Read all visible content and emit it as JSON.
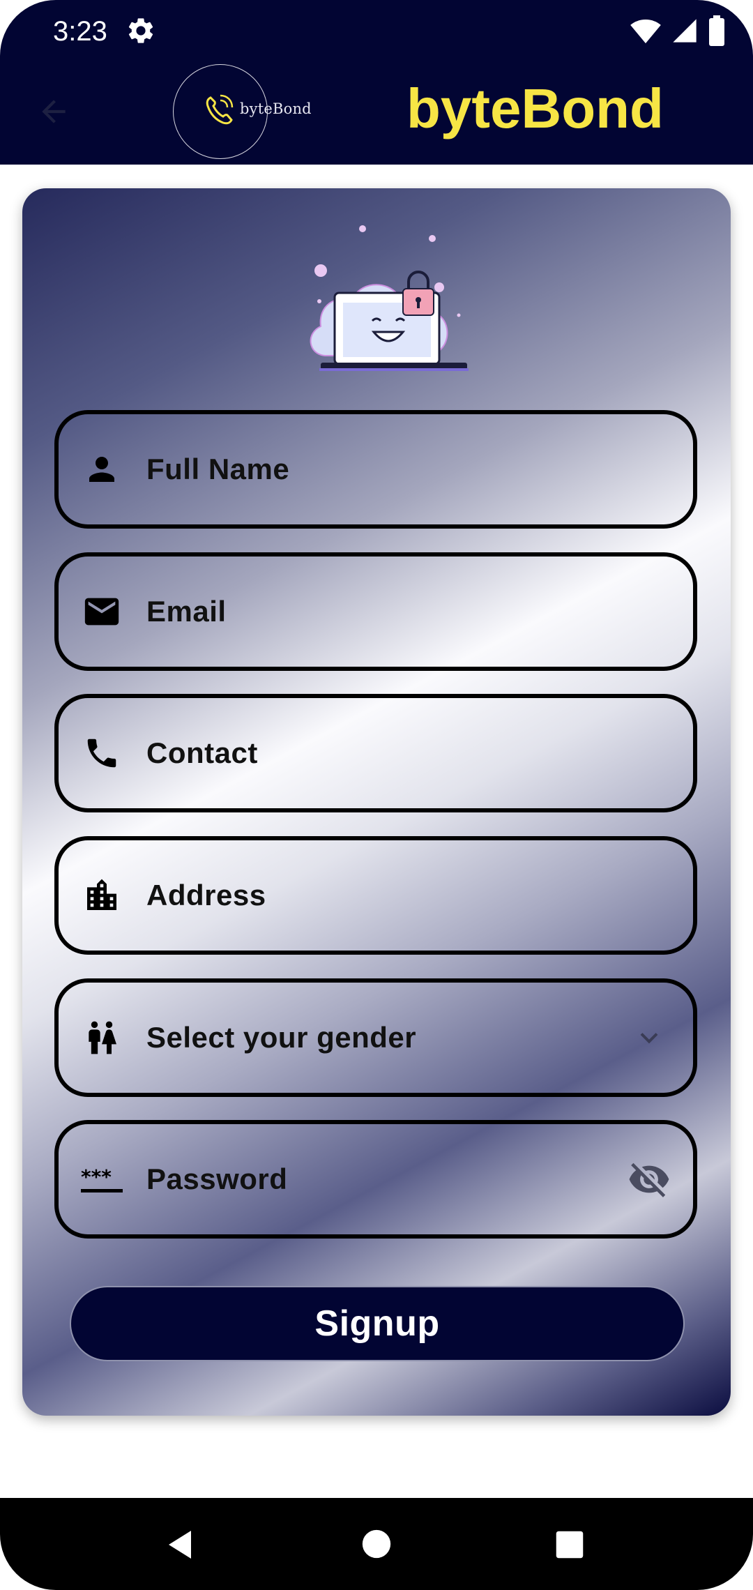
{
  "status_bar": {
    "time": "3:23",
    "icons": [
      "gear-icon",
      "wifi-icon",
      "signal-icon",
      "battery-icon"
    ]
  },
  "app_bar": {
    "title": "byteBond",
    "logo_text": "byteBond",
    "back_icon": "arrow-back-icon",
    "colors": {
      "background": "#020533",
      "title": "#f7e545"
    }
  },
  "form": {
    "illustration": "laptop-lock-illustration",
    "fields": {
      "full_name": {
        "placeholder": "Full Name",
        "icon": "person-icon"
      },
      "email": {
        "placeholder": "Email",
        "icon": "mail-icon"
      },
      "contact": {
        "placeholder": "Contact",
        "icon": "phone-icon"
      },
      "address": {
        "placeholder": "Address",
        "icon": "building-icon"
      },
      "gender": {
        "placeholder": "Select your gender",
        "icon": "wc-icon",
        "trailing_icon": "chevron-down-icon"
      },
      "password": {
        "placeholder": "Password",
        "icon": "password-icon",
        "trailing_icon": "visibility-off-icon"
      }
    },
    "submit_label": "Signup",
    "colors": {
      "button": "#020533",
      "border": "#000000"
    }
  },
  "nav_bar": {
    "icons": [
      "nav-back-icon",
      "nav-home-icon",
      "nav-recents-icon"
    ]
  }
}
